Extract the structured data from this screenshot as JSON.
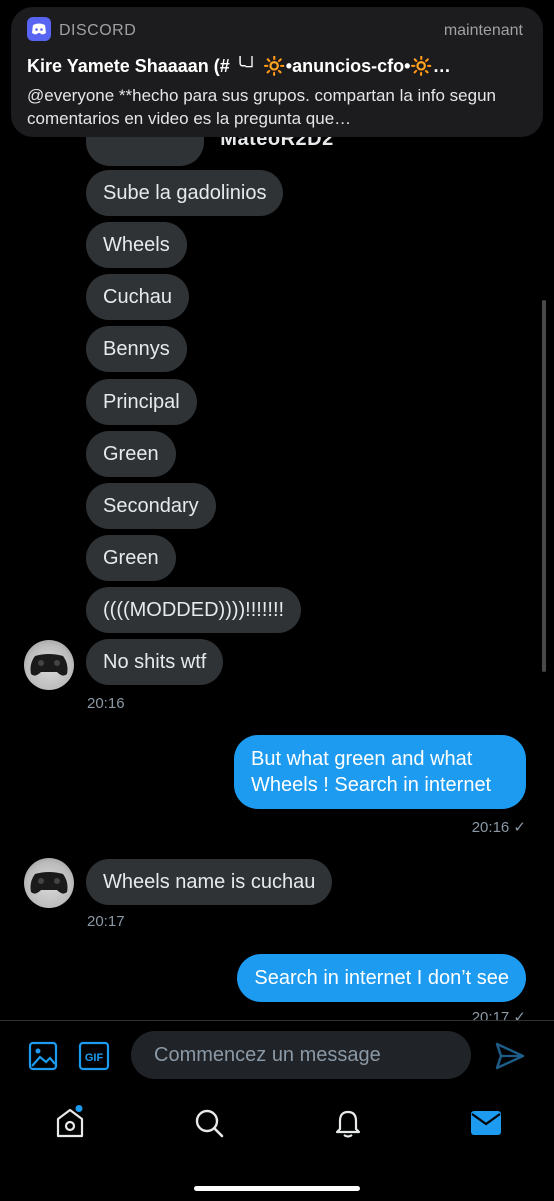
{
  "notification": {
    "app_name": "DISCORD",
    "time": "maintenant",
    "title": "Kire Yamete Shaaaan (# ╰┘ 🔆•anuncios-cfo•🔆…",
    "body": "@everyone  **hecho para sus grupos. compartan la info segun comentarios en video es la pregunta que…"
  },
  "conversation": {
    "contact_name": "MateoR2D2",
    "messages_in_a": [
      "Sube la gadolinios",
      "Wheels",
      "Cuchau",
      "Bennys",
      "Principal",
      "Green",
      "Secondary",
      "Green",
      "((((MODDED))))!!!!!!!",
      "No shits wtf"
    ],
    "time_a": "20:16",
    "out_1": "But what green and what Wheels ! Search in internet",
    "time_out_1": "20:16 ✓",
    "in_b": "Wheels name is cuchau",
    "time_b": "20:17",
    "out_2": "Search in internet I don’t see",
    "time_out_2": "20:17 ✓"
  },
  "composer": {
    "placeholder": "Commencez un message"
  },
  "colors": {
    "accent": "#1d9bf0",
    "bubble_in": "#2f3336",
    "background": "#000000"
  },
  "icons": [
    "image-icon",
    "gif-icon",
    "send-icon",
    "home-icon",
    "search-icon",
    "notifications-icon",
    "messages-icon"
  ]
}
